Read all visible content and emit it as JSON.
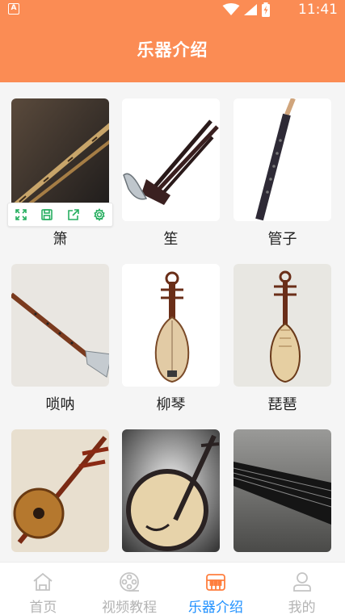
{
  "status_bar": {
    "time": "11:41",
    "app_badge": "A",
    "icons": [
      "wifi-icon",
      "signal-icon",
      "battery-icon"
    ]
  },
  "header": {
    "title": "乐器介绍"
  },
  "instruments": [
    {
      "label": "箫"
    },
    {
      "label": "笙"
    },
    {
      "label": "管子"
    },
    {
      "label": "唢呐"
    },
    {
      "label": "柳琴"
    },
    {
      "label": "琵琶"
    },
    {
      "label": ""
    },
    {
      "label": ""
    },
    {
      "label": ""
    }
  ],
  "float_toolbar": {
    "icons": [
      "expand-icon",
      "save-icon",
      "share-icon",
      "settings-icon"
    ]
  },
  "bottom_nav": {
    "items": [
      {
        "label": "首页",
        "icon": "home-icon",
        "active": false
      },
      {
        "label": "视频教程",
        "icon": "film-reel-icon",
        "active": false
      },
      {
        "label": "乐器介绍",
        "icon": "piano-icon",
        "active": true
      },
      {
        "label": "我的",
        "icon": "user-icon",
        "active": false
      }
    ]
  },
  "colors": {
    "header_bg": "#fb8c54",
    "active_tab": "#1e90ff",
    "inactive_tab": "#b3b3b3",
    "toolbar_icon": "#27ae60"
  }
}
